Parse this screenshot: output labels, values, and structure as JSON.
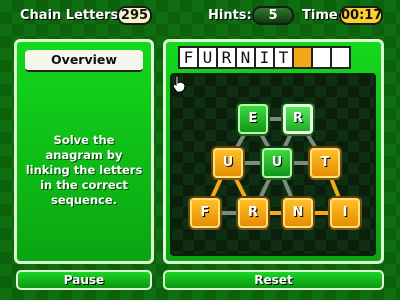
{
  "header": {
    "title": "Chain Letters",
    "score": "295",
    "hints_label": "Hints:",
    "hints": "5",
    "time_label": "Time:",
    "time": "00:17"
  },
  "overview": {
    "title": "Overview",
    "instructions": "Solve the anagram by linking the letters in the correct sequence."
  },
  "answer": {
    "letters": [
      "F",
      "U",
      "R",
      "N",
      "I",
      "T",
      "",
      "",
      ""
    ]
  },
  "board": {
    "tiles": [
      {
        "letter": "E",
        "state": "unused"
      },
      {
        "letter": "R",
        "state": "selected"
      },
      {
        "letter": "U",
        "state": "used"
      },
      {
        "letter": "U",
        "state": "unused"
      },
      {
        "letter": "T",
        "state": "used"
      },
      {
        "letter": "F",
        "state": "used"
      },
      {
        "letter": "R",
        "state": "used"
      },
      {
        "letter": "N",
        "state": "used"
      },
      {
        "letter": "I",
        "state": "used"
      }
    ]
  },
  "buttons": {
    "pause": "Pause",
    "reset": "Reset"
  },
  "colors": {
    "background": "#0f6e0f",
    "panel": "#14d81c",
    "used_tile": "#f2a818",
    "unused_tile": "#2fc034",
    "time_box": "#f8d030"
  }
}
